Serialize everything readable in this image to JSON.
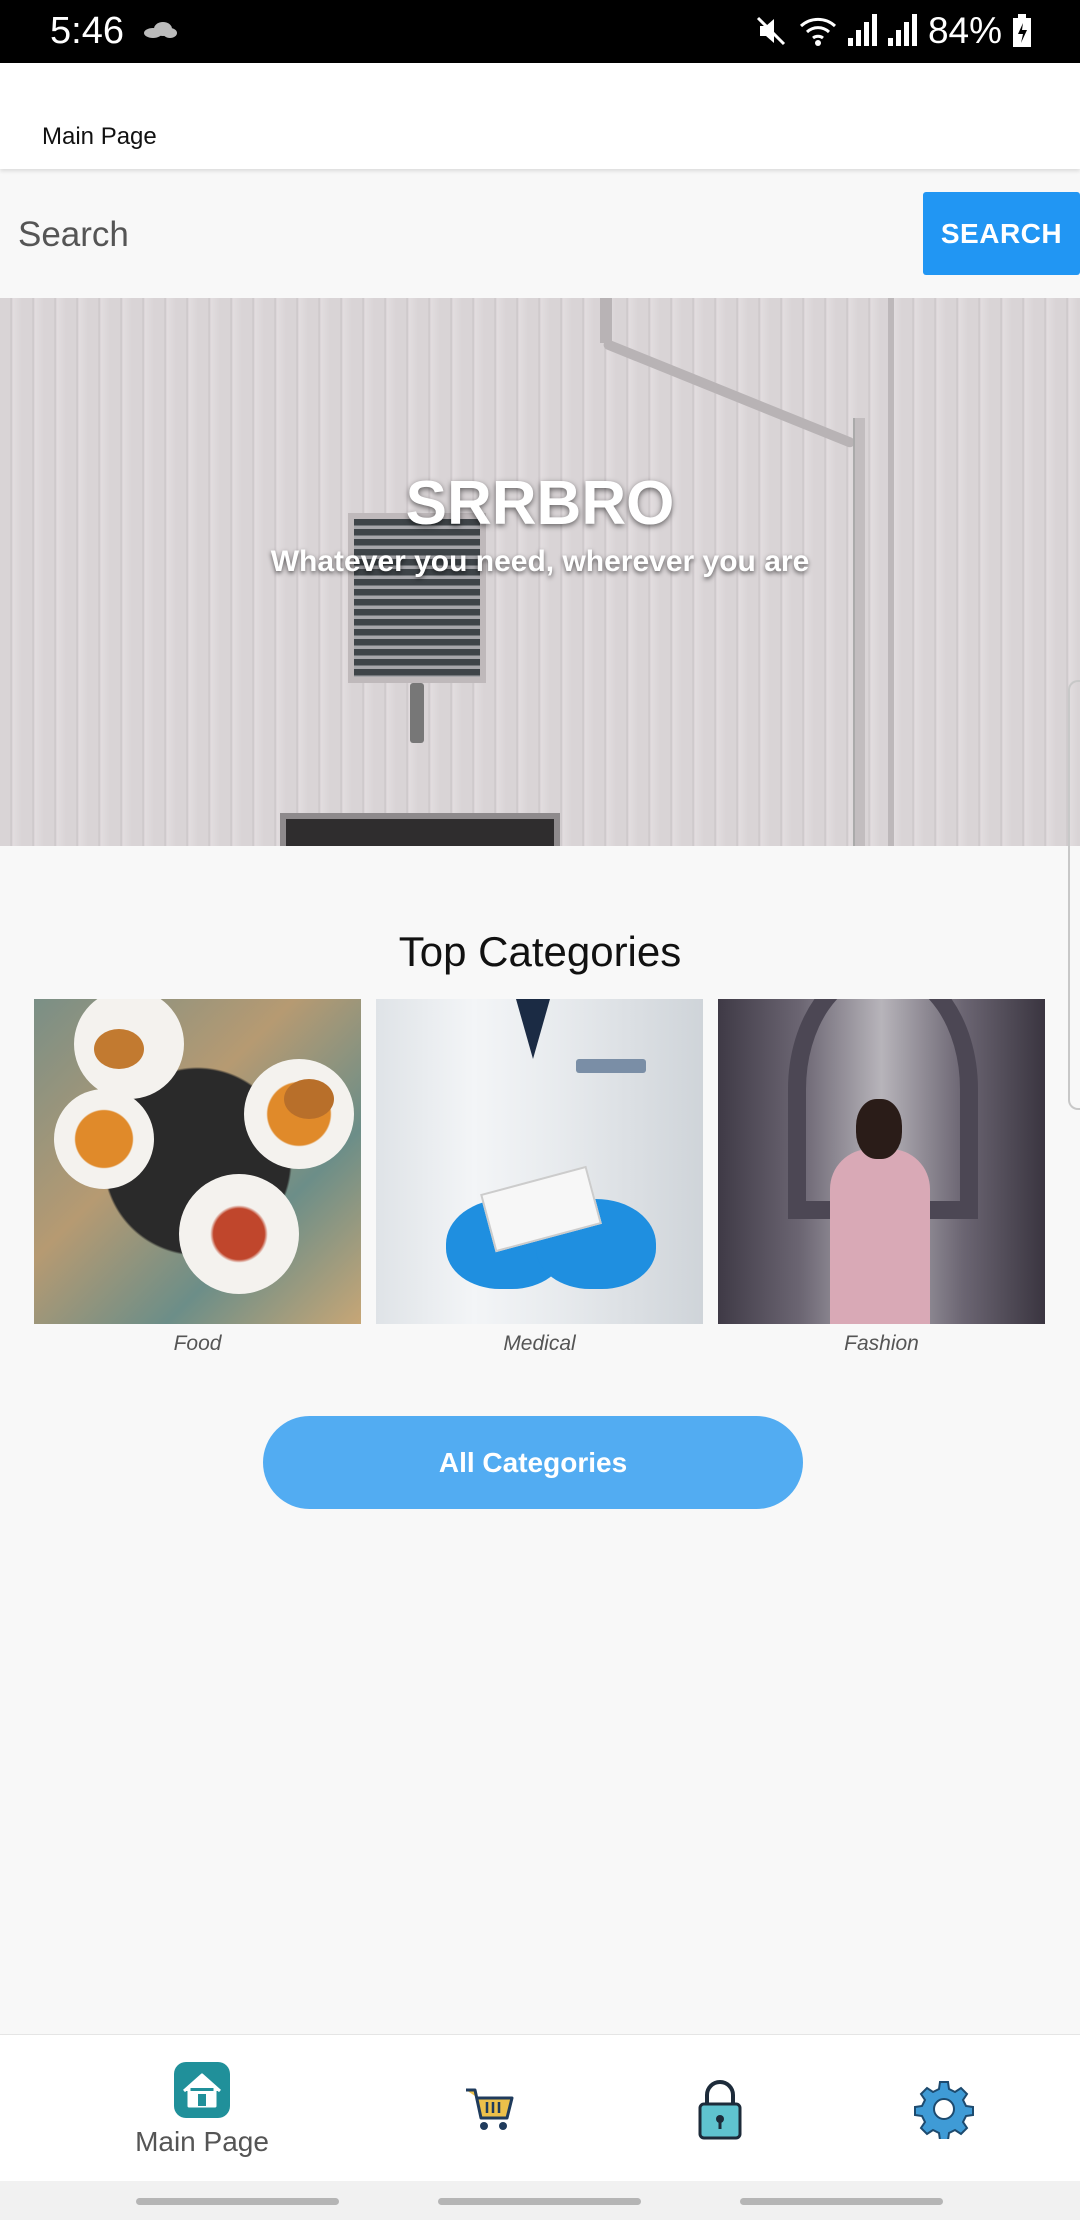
{
  "status_bar": {
    "time": "5:46",
    "battery": "84%"
  },
  "app_bar": {
    "title": "Main Page"
  },
  "search": {
    "placeholder": "Search",
    "button_label": "SEARCH"
  },
  "hero": {
    "title": "SRRBRO",
    "subtitle": "Whatever you need, wherever you are"
  },
  "categories": {
    "heading": "Top Categories",
    "items": [
      {
        "label": "Food"
      },
      {
        "label": "Medical"
      },
      {
        "label": "Fashion"
      }
    ],
    "all_button": "All Categories"
  },
  "bottom_nav": {
    "items": [
      {
        "label": "Main Page",
        "icon": "home-icon",
        "active": true
      },
      {
        "label": "",
        "icon": "cart-icon"
      },
      {
        "label": "",
        "icon": "lock-icon"
      },
      {
        "label": "",
        "icon": "gear-icon"
      }
    ]
  },
  "colors": {
    "accent": "#2196f3",
    "button_light": "#52acf2",
    "home_icon": "#20909a"
  }
}
